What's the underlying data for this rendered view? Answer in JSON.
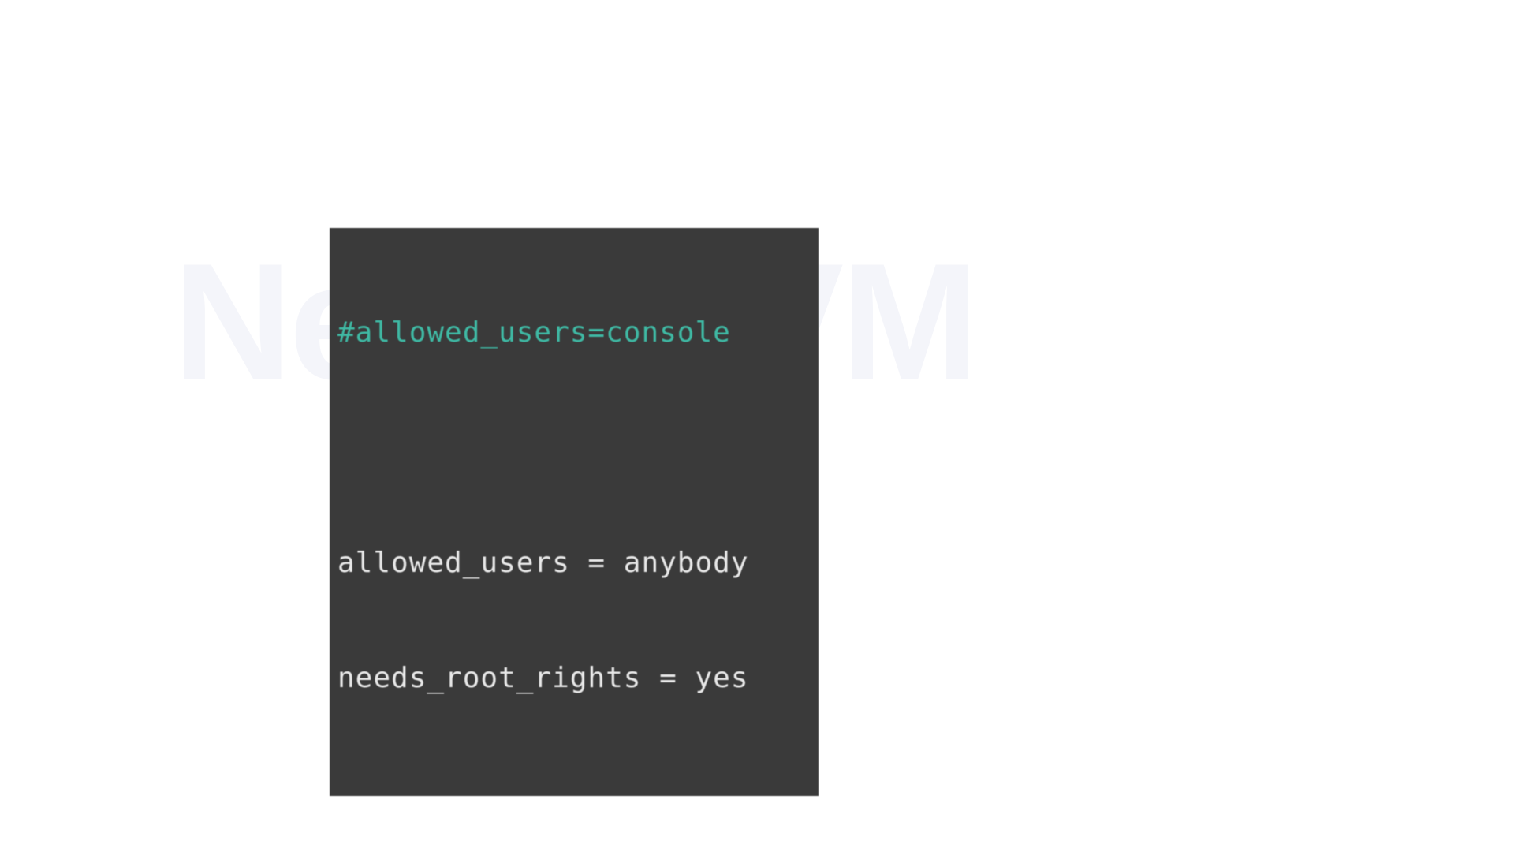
{
  "watermark": "NeuronVM",
  "code": {
    "line1": "#allowed_users=console",
    "line2": "allowed_users = anybody",
    "line3": "needs_root_rights = yes"
  },
  "colors": {
    "background": "#ffffff",
    "code_bg": "#3a3a3a",
    "comment": "#3fb9a4",
    "plain_text": "#e8e8e8",
    "watermark": "#f4f5fa"
  }
}
